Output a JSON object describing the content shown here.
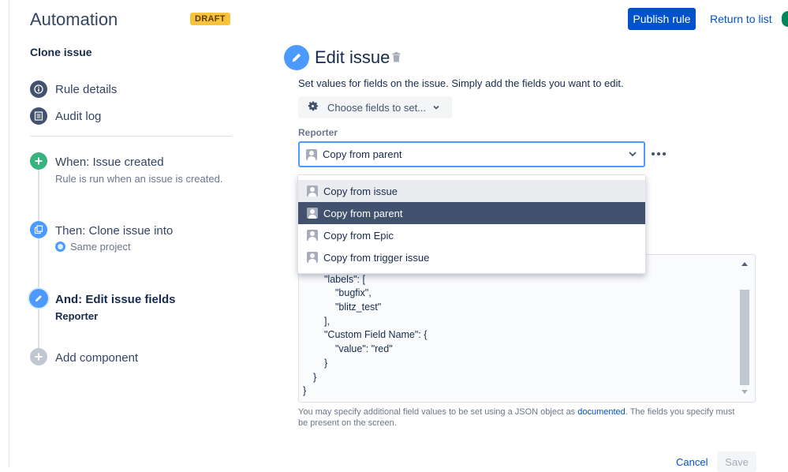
{
  "app": {
    "title": "Automation",
    "status_badge": "DRAFT"
  },
  "header": {
    "publish_label": "Publish rule",
    "return_label": "Return to list"
  },
  "sidebar": {
    "rule_name": "Clone issue",
    "nav": [
      {
        "label": "Rule details",
        "icon": "info-icon"
      },
      {
        "label": "Audit log",
        "icon": "list-icon"
      }
    ],
    "steps": [
      {
        "title": "When: Issue created",
        "subtitle": "Rule is run when an issue is created.",
        "icon": "plus-icon",
        "color": "#36b37e"
      },
      {
        "title": "Then: Clone issue into",
        "subtitle": "Same project",
        "icon": "clone-icon",
        "color": "#4c9aff"
      },
      {
        "title": "And: Edit issue fields",
        "subtitle": "Reporter",
        "icon": "pencil-icon",
        "color": "#4c9aff"
      }
    ],
    "add_component_label": "Add component"
  },
  "panel": {
    "title": "Edit issue",
    "description": "Set values for fields on the issue. Simply add the fields you want to edit.",
    "choose_fields_label": "Choose fields to set...",
    "field_label": "Reporter",
    "selected_value": "Copy from parent",
    "options": [
      "Copy from issue",
      "Copy from parent",
      "Copy from Epic",
      "Copy from trigger issue"
    ],
    "json_lines": [
      "\"labels\": [",
      "\"bugfix\",",
      "\"blitz_test\"",
      "],",
      "\"Custom Field Name\": {",
      "\"value\": \"red\"",
      "}",
      "}",
      "}"
    ],
    "help_before": "You may specify additional field values to be set using a JSON object as ",
    "help_link": "documented",
    "help_after": ". The fields you specify must be present on the screen.",
    "cancel_label": "Cancel",
    "save_label": "Save"
  },
  "colors": {
    "primary": "#0052cc",
    "badge": "#f9c23c",
    "selected_option": "#42526e"
  }
}
